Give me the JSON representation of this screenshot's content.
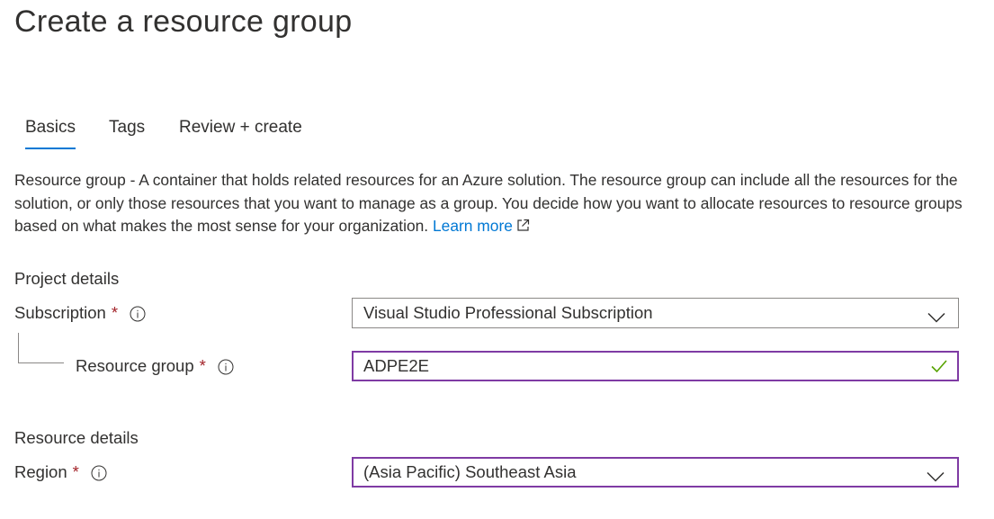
{
  "page": {
    "title": "Create a resource group"
  },
  "tabs": [
    {
      "label": "Basics",
      "active": true
    },
    {
      "label": "Tags",
      "active": false
    },
    {
      "label": "Review + create",
      "active": false
    }
  ],
  "description": {
    "term": "Resource group",
    "text": " - A container that holds related resources for an Azure solution. The resource group can include all the resources for the solution, or only those resources that you want to manage as a group. You decide how you want to allocate resources to resource groups based on what makes the most sense for your organization. ",
    "learn_more": "Learn more",
    "learn_more_icon": "external-link-icon"
  },
  "project_details": {
    "heading": "Project details",
    "subscription": {
      "label": "Subscription",
      "required_mark": "*",
      "info_icon": "info-icon",
      "value": "Visual Studio Professional Subscription"
    },
    "resource_group": {
      "label": "Resource group",
      "required_mark": "*",
      "info_icon": "info-icon",
      "value": "ADPE2E",
      "valid": true
    }
  },
  "resource_details": {
    "heading": "Resource details",
    "region": {
      "label": "Region",
      "required_mark": "*",
      "info_icon": "info-icon",
      "value": "(Asia Pacific) Southeast Asia"
    }
  },
  "colors": {
    "accent": "#0078d4",
    "focus_border": "#7f3ba4",
    "required": "#a4262c",
    "valid_check": "#57a300",
    "text": "#323130"
  }
}
